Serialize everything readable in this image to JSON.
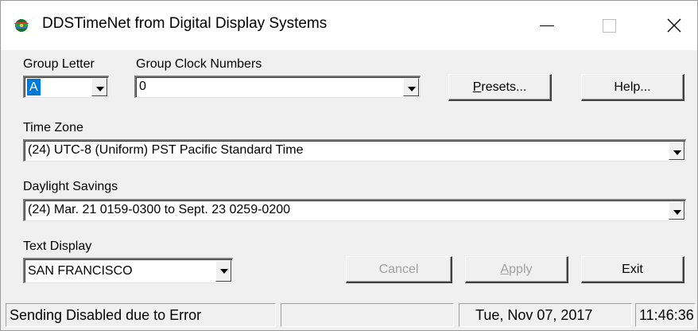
{
  "window": {
    "title": "DDSTimeNet from Digital Display Systems",
    "icon": "dds-globe-icon",
    "controls": {
      "minimize": "minimize-icon",
      "maximize": "maximize-icon",
      "close": "close-icon"
    }
  },
  "group_letter": {
    "label": "Group Letter",
    "value": "A"
  },
  "group_clock_numbers": {
    "label": "Group Clock Numbers",
    "value": "0"
  },
  "buttons": {
    "presets": {
      "label_underlined": "P",
      "label_rest": "resets..."
    },
    "help": "Help...",
    "cancel": "Cancel",
    "apply": {
      "label_underlined": "A",
      "label_rest": "pply"
    },
    "exit": "Exit"
  },
  "time_zone": {
    "label": "Time Zone",
    "value": "(24) UTC-8 (Uniform) PST Pacific Standard Time"
  },
  "daylight_savings": {
    "label": "Daylight Savings",
    "value": "(24) Mar. 21 0159-0300 to Sept. 23 0259-0200"
  },
  "text_display": {
    "label": "Text Display",
    "value": "SAN FRANCISCO"
  },
  "status_bar": {
    "message": "Sending Disabled due to Error",
    "empty_panel": "",
    "date": "Tue, Nov 07, 2017",
    "time": "11:46:36"
  },
  "colors": {
    "selection": "#0078d7",
    "face": "#f0f0f0",
    "disabled_text": "#a0a0a0"
  }
}
